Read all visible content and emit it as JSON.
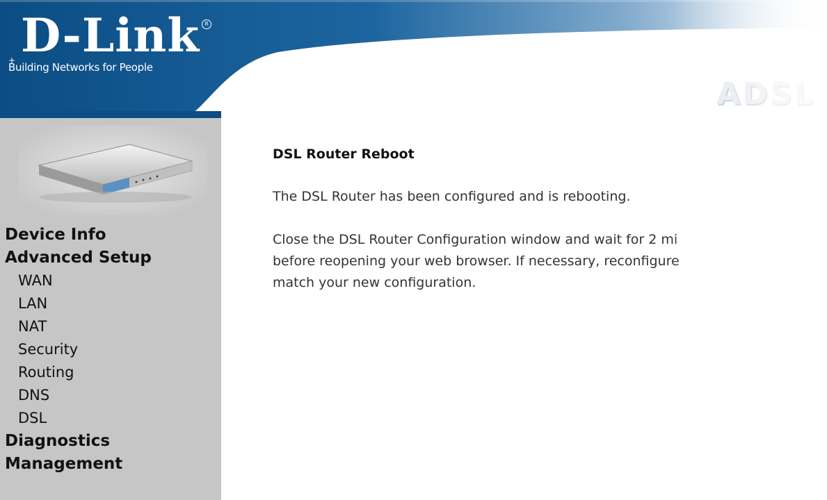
{
  "header": {
    "logo_text": "D-Link",
    "tagline": "Building Networks for People",
    "banner_title": "ADSL R"
  },
  "sidebar": {
    "router_image": "router-device-icon",
    "items": [
      {
        "label": "Device Info",
        "level": "top"
      },
      {
        "label": "Advanced Setup",
        "level": "top"
      },
      {
        "label": "WAN",
        "level": "sub"
      },
      {
        "label": "LAN",
        "level": "sub"
      },
      {
        "label": "NAT",
        "level": "sub"
      },
      {
        "label": "Security",
        "level": "sub"
      },
      {
        "label": "Routing",
        "level": "sub"
      },
      {
        "label": "DNS",
        "level": "sub"
      },
      {
        "label": "DSL",
        "level": "sub"
      },
      {
        "label": "Diagnostics",
        "level": "top"
      },
      {
        "label": "Management",
        "level": "top"
      }
    ]
  },
  "main": {
    "title": "DSL Router Reboot",
    "message1": "The DSL Router has been configured and is rebooting.",
    "message2_line1": "Close the DSL Router Configuration window and wait for 2 mi",
    "message2_line2": "before reopening your web browser. If necessary, reconfigure",
    "message2_line3": "match your new configuration."
  },
  "colors": {
    "header_blue": "#1f5c8e",
    "sidebar_gray": "#c6c6c6",
    "banner_text": "#dde3e9"
  }
}
